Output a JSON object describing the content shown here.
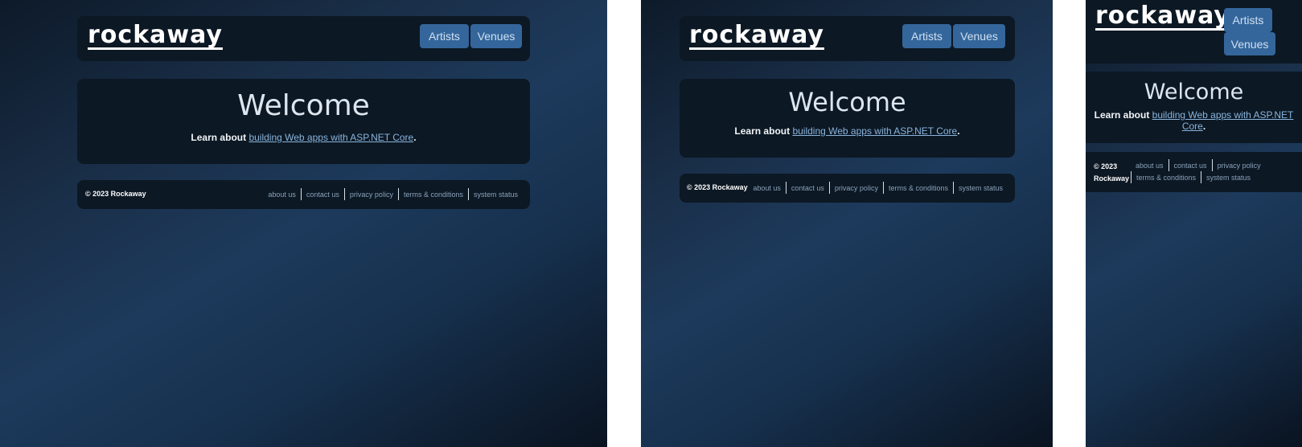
{
  "brand": {
    "logo_text": "rockaway"
  },
  "nav": {
    "artists_label": "Artists",
    "venues_label": "Venues"
  },
  "hero": {
    "title": "Welcome",
    "lead": "Learn about ",
    "link_text": "building Web apps with ASP.NET Core",
    "trail": "."
  },
  "footer": {
    "copyright": "© 2023 Rockaway",
    "copyright_line1": "© 2023",
    "copyright_line2": "Rockaway",
    "links": [
      "about us",
      "contact us",
      "privacy policy",
      "terms & conditions",
      "system status"
    ]
  },
  "colors": {
    "page_bg_start": "#0d1a29",
    "page_bg_mid": "#1d3a5c",
    "page_bg_end": "#0a1320",
    "card_bg": "#0c1824",
    "button_bg": "#34669b",
    "link": "#8ab4dc"
  }
}
